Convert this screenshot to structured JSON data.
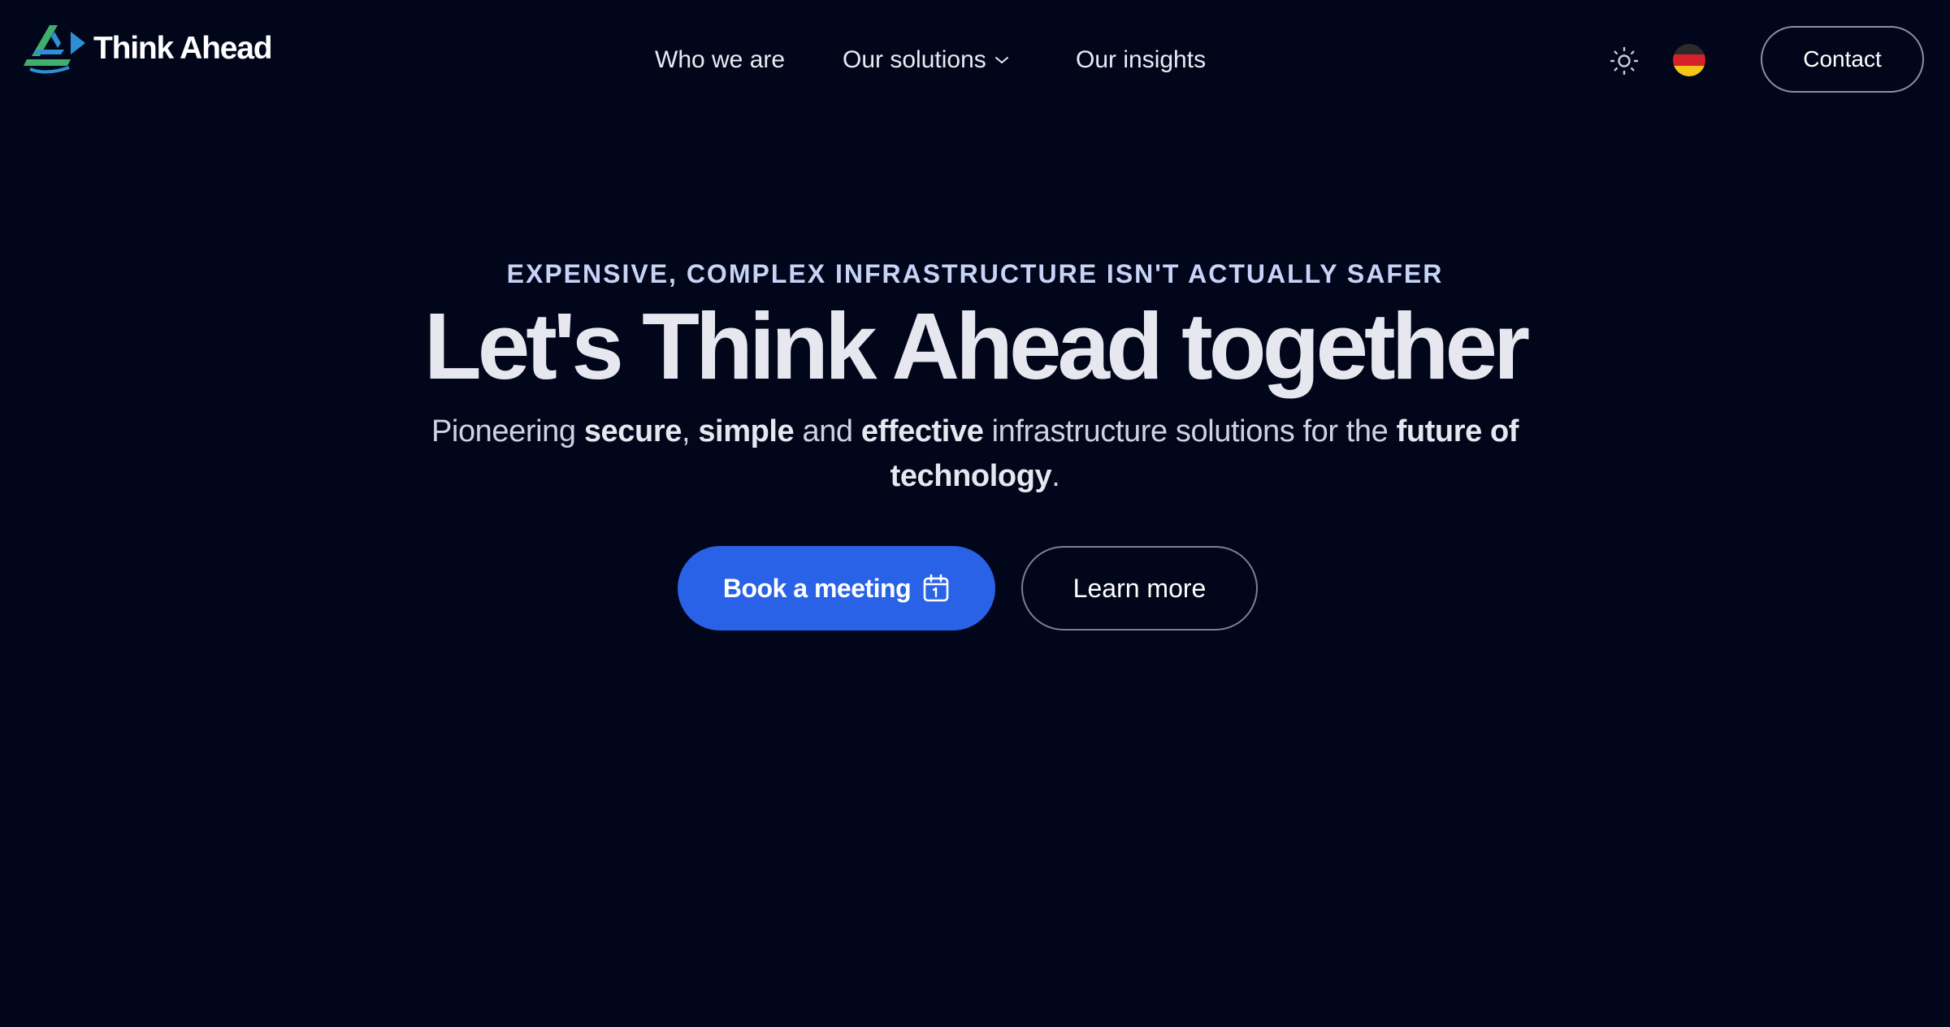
{
  "brand": {
    "name": "Think Ahead",
    "logo_icon": "think-ahead-logo-icon"
  },
  "nav": {
    "items": [
      {
        "label": "Who we are"
      },
      {
        "label": "Our solutions",
        "has_dropdown": true,
        "icon": "chevron-down-icon"
      },
      {
        "label": "Our insights"
      }
    ]
  },
  "header_actions": {
    "theme_icon": "sun-icon",
    "language_icon": "germany-flag-icon",
    "contact_label": "Contact"
  },
  "hero": {
    "eyebrow": "EXPENSIVE, COMPLEX INFRASTRUCTURE ISN'T ACTUALLY SAFER",
    "headline": "Let's Think Ahead together",
    "subtitle": {
      "pioneering": "Pioneering",
      "secure": "secure",
      "comma": ",",
      "simple": "simple",
      "and": "and",
      "effective": "effective",
      "middle": "infrastructure solutions for the",
      "future_of": "future of",
      "technology": "technology",
      "period": "."
    },
    "primary_cta": {
      "label": "Book a meeting",
      "icon": "calendar-icon"
    },
    "secondary_cta": {
      "label": "Learn more"
    }
  },
  "colors": {
    "background": "#02061a",
    "primary_button": "#2962e6",
    "eyebrow": "#c7d4f7",
    "logo_green": "#3fae6e",
    "logo_blue": "#2f8fd6"
  }
}
